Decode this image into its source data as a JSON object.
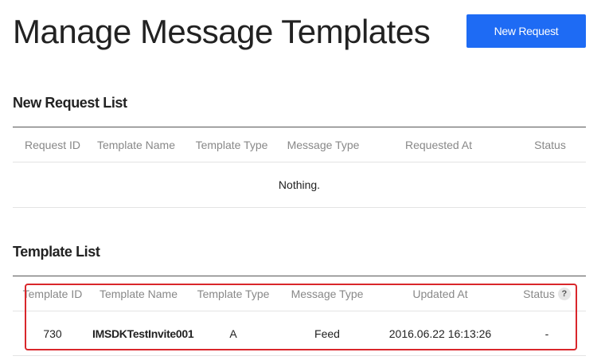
{
  "page": {
    "title": "Manage Message Templates"
  },
  "toolbar": {
    "new_request_label": "New Request"
  },
  "new_request_list": {
    "heading": "New Request List",
    "columns": [
      "Request ID",
      "Template Name",
      "Template Type",
      "Message Type",
      "Requested At",
      "Status"
    ],
    "empty_text": "Nothing."
  },
  "template_list": {
    "heading": "Template List",
    "columns": [
      "Template ID",
      "Template Name",
      "Template Type",
      "Message Type",
      "Updated At",
      "Status"
    ],
    "help_icon_glyph": "?",
    "rows": [
      {
        "template_id": "730",
        "template_name": "IMSDKTestInvite001",
        "template_type": "A",
        "message_type": "Feed",
        "updated_at": "2016.06.22 16:13:26",
        "status": "-"
      }
    ]
  },
  "colors": {
    "primary_button": "#1e6bf4",
    "highlight": "#d9262b"
  }
}
